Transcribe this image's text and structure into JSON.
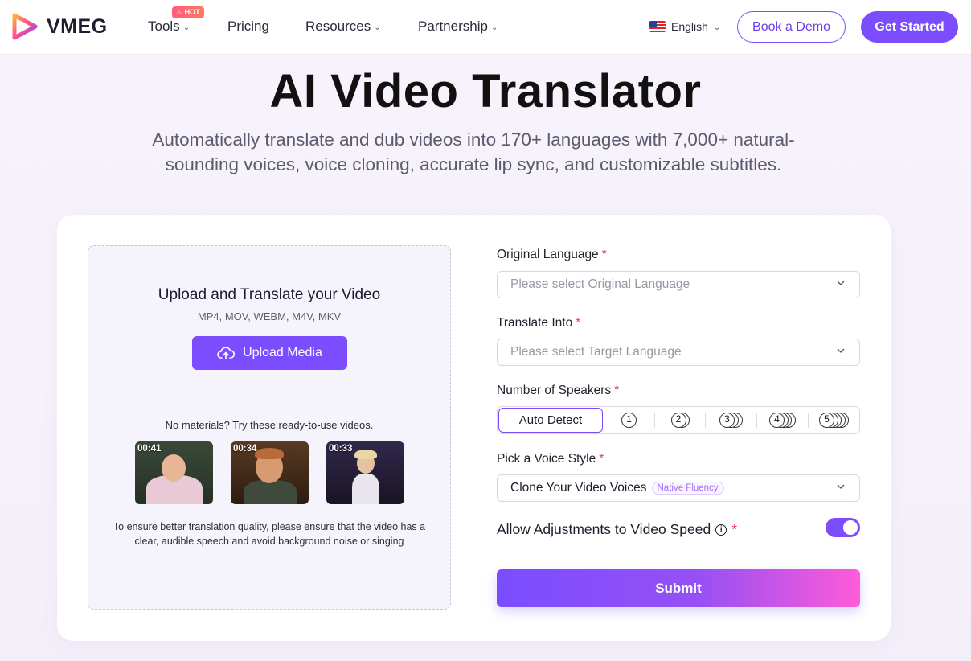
{
  "nav": {
    "brand": "VMEG",
    "items": [
      {
        "label": "Tools",
        "has_dropdown": true,
        "badge": "HOT"
      },
      {
        "label": "Pricing",
        "has_dropdown": false
      },
      {
        "label": "Resources",
        "has_dropdown": true
      },
      {
        "label": "Partnership",
        "has_dropdown": true
      }
    ],
    "language": "English",
    "book_demo": "Book a Demo",
    "get_started": "Get Started"
  },
  "hero": {
    "title": "AI Video Translator",
    "subtitle": "Automatically translate and dub videos into 170+ languages with 7,000+ natural-sounding voices, voice cloning, accurate lip sync, and customizable subtitles."
  },
  "upload": {
    "title": "Upload and Translate your Video",
    "formats": "MP4, MOV, WEBM, M4V, MKV",
    "button": "Upload Media",
    "samples_prompt": "No materials? Try these ready-to-use videos.",
    "samples": [
      {
        "duration": "00:41"
      },
      {
        "duration": "00:34"
      },
      {
        "duration": "00:33"
      }
    ],
    "hint": "To ensure better translation quality, please ensure that the video has a clear, audible speech and avoid background noise or singing"
  },
  "form": {
    "original_language": {
      "label": "Original Language",
      "placeholder": "Please select Original Language"
    },
    "translate_into": {
      "label": "Translate Into",
      "placeholder": "Please select Target Language"
    },
    "speakers": {
      "label": "Number of Speakers",
      "selected": "Auto Detect",
      "options": [
        "1",
        "2",
        "3",
        "4",
        "5"
      ]
    },
    "voice_style": {
      "label": "Pick a Voice Style",
      "value": "Clone Your Video Voices",
      "badge": "Native Fluency"
    },
    "speed": {
      "label": "Allow Adjustments to Video Speed",
      "enabled": true
    },
    "required_mark": "*",
    "submit": "Submit"
  },
  "colors": {
    "accent": "#7b4dff",
    "required": "#ef3b5a",
    "submit_gradient_end": "#ff5bd9",
    "hot_badge": "#ff5b82"
  },
  "icons": {
    "logo": "play-triangle-logo-icon",
    "upload": "cloud-upload-icon",
    "dropdown": "chevron-down-icon",
    "info": "info-icon",
    "flag": "us-flag-icon"
  }
}
